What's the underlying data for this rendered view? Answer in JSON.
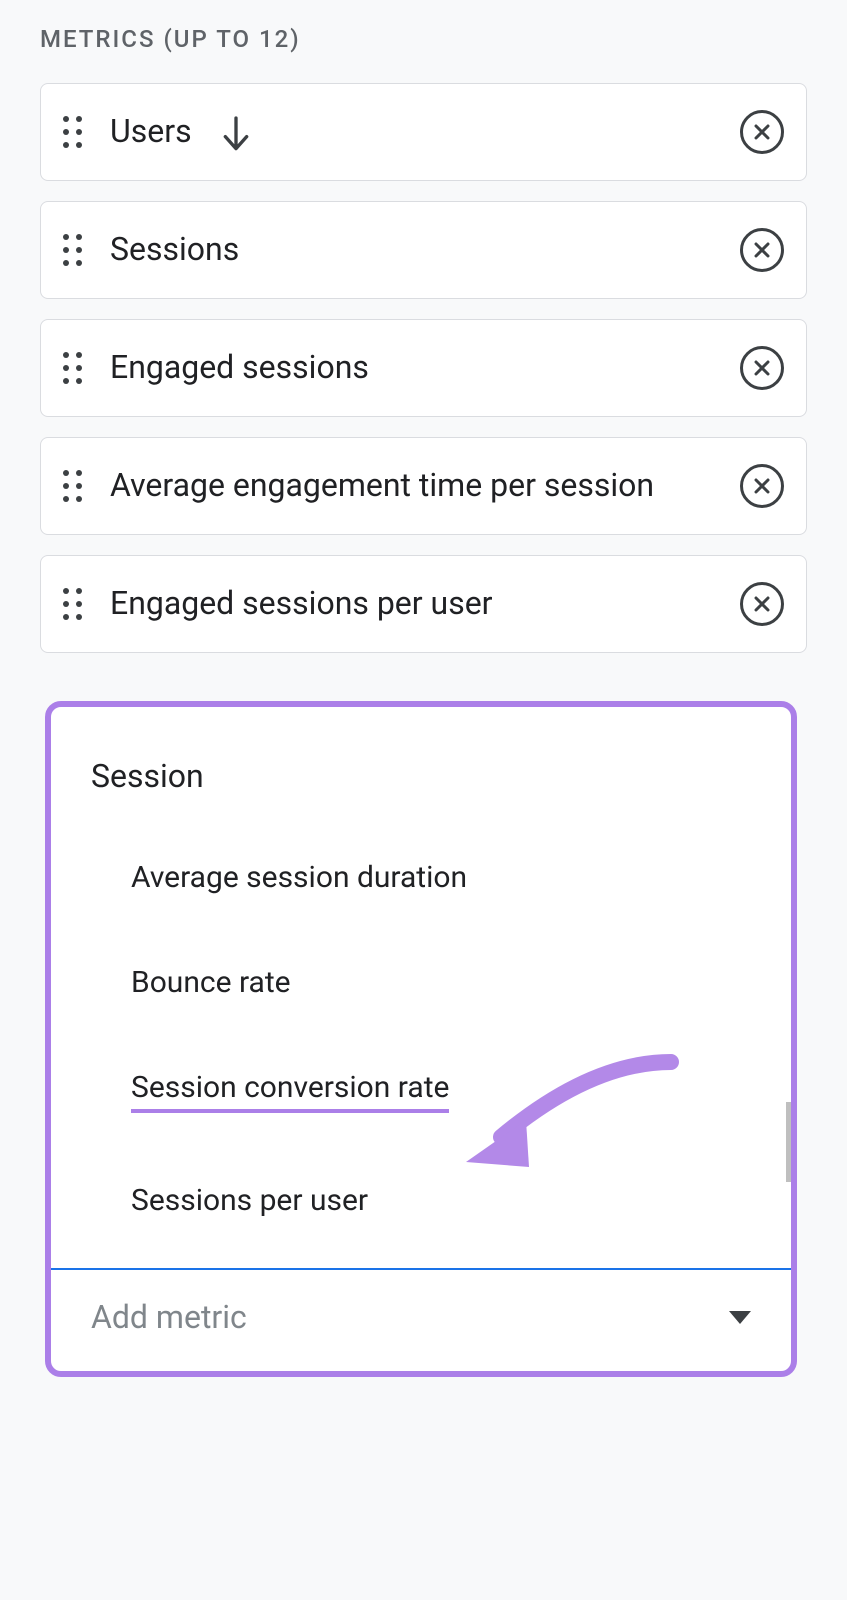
{
  "section": {
    "header": "METRICS (UP TO 12)"
  },
  "metrics": [
    {
      "label": "Users",
      "sorted": true
    },
    {
      "label": "Sessions",
      "sorted": false
    },
    {
      "label": "Engaged sessions",
      "sorted": false
    },
    {
      "label": "Average engagement time per session",
      "sorted": false
    },
    {
      "label": "Engaged sessions per user",
      "sorted": false
    }
  ],
  "dropdown": {
    "group_title": "Session",
    "items": [
      "Average session duration",
      "Bounce rate",
      "Session conversion rate",
      "Sessions per user"
    ],
    "highlighted_index": 2,
    "add_label": "Add metric"
  }
}
